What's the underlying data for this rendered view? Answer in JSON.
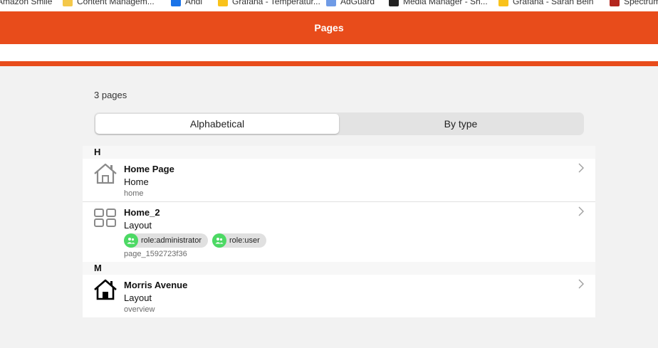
{
  "bookmarks": [
    {
      "label": "Amazon Smile",
      "icon": "amazon-icon"
    },
    {
      "label": "Content Managem...",
      "icon": "folder-icon"
    },
    {
      "label": "Ahdi",
      "icon": "bookmark-icon"
    },
    {
      "label": "Grafana - Temperatur...",
      "icon": "grafana-icon"
    },
    {
      "label": "AdGuard",
      "icon": "doc-icon"
    },
    {
      "label": "Media Manager - Sh...",
      "icon": "media-icon"
    },
    {
      "label": "Grafana - Saran Bein",
      "icon": "grafana-icon"
    },
    {
      "label": "Spectrum",
      "icon": "spectrum-icon"
    }
  ],
  "header": {
    "title": "Pages"
  },
  "summary": {
    "count_label": "3 pages"
  },
  "tabs": [
    {
      "label": "Alphabetical",
      "active": true
    },
    {
      "label": "By type",
      "active": false
    }
  ],
  "sections": [
    {
      "letter": "H",
      "items": [
        {
          "title": "Home Page",
          "type": "Home",
          "path": "home",
          "icon": "house-outline-icon",
          "roles": []
        },
        {
          "title": "Home_2",
          "type": "Layout",
          "path": "page_1592723f36",
          "icon": "grid-layout-icon",
          "roles": [
            "role:administrator",
            "role:user"
          ]
        }
      ]
    },
    {
      "letter": "M",
      "items": [
        {
          "title": "Morris Avenue",
          "type": "Layout",
          "path": "overview",
          "icon": "house-icon",
          "roles": []
        }
      ]
    }
  ],
  "colors": {
    "accent": "#e84c1b",
    "chip_dot": "#4cd964",
    "background": "#f2f2f2"
  }
}
